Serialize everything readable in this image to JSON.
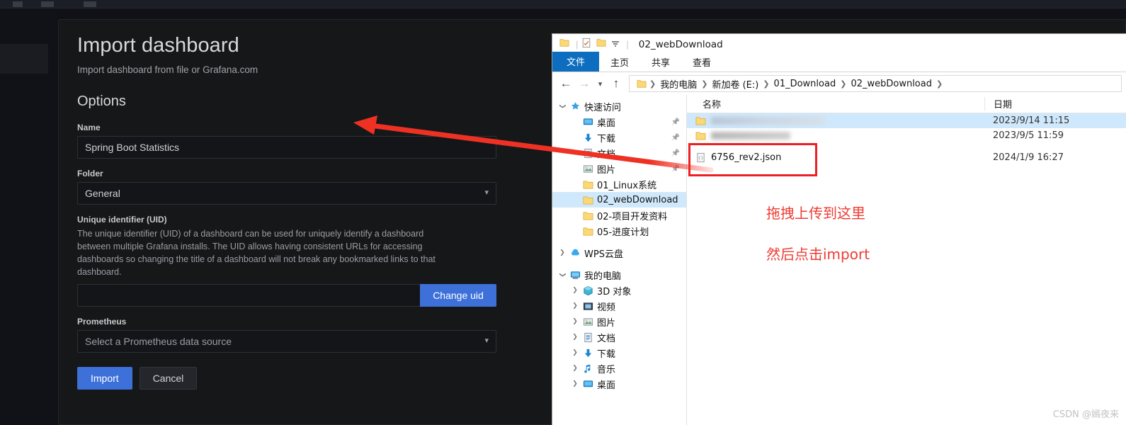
{
  "grafana": {
    "page_title": "Import dashboard",
    "page_subtitle": "Import dashboard from file or Grafana.com",
    "section_title": "Options",
    "name_field": {
      "label": "Name",
      "value": "Spring Boot Statistics"
    },
    "folder_field": {
      "label": "Folder",
      "value": "General",
      "chevron": "chevron-down-icon"
    },
    "uid_field": {
      "label": "Unique identifier (UID)",
      "description": "The unique identifier (UID) of a dashboard can be used for uniquely identify a dashboard between multiple Grafana installs. The UID allows having consistent URLs for accessing dashboards so changing the title of a dashboard will not break any bookmarked links to that dashboard.",
      "value": "",
      "button_label": "Change uid"
    },
    "datasource_field": {
      "label": "Prometheus",
      "placeholder": "Select a Prometheus data source",
      "value": "Select a Prometheus data source"
    },
    "import_button": "Import",
    "cancel_button": "Cancel"
  },
  "explorer": {
    "window_title": "02_webDownload",
    "quick_access_icons": [
      "folder-icon",
      "properties-icon",
      "new-folder-icon",
      "customize-toolbar-chevron-icon"
    ],
    "ribbon_tabs": [
      {
        "label": "文件",
        "active": true
      },
      {
        "label": "主页",
        "active": false
      },
      {
        "label": "共享",
        "active": false
      },
      {
        "label": "查看",
        "active": false
      }
    ],
    "nav": {
      "back": "back-arrow-icon",
      "forward": "forward-arrow-icon",
      "recent": "recent-locations-chevron-icon",
      "up": "up-arrow-icon"
    },
    "breadcrumbs": [
      "我的电脑",
      "新加卷 (E:)",
      "01_Download",
      "02_webDownload"
    ],
    "tree": [
      {
        "label": "快速访问",
        "icon": "pin-star-icon",
        "indent": 0,
        "arrow": "expanded",
        "selected": false,
        "pinned": false
      },
      {
        "label": "桌面",
        "icon": "desktop-icon",
        "indent": 1,
        "arrow": "none",
        "selected": false,
        "pinned": true
      },
      {
        "label": "下载",
        "icon": "download-icon",
        "indent": 1,
        "arrow": "none",
        "selected": false,
        "pinned": true
      },
      {
        "label": "文档",
        "icon": "documents-icon",
        "indent": 1,
        "arrow": "none",
        "selected": false,
        "pinned": true
      },
      {
        "label": "图片",
        "icon": "pictures-icon",
        "indent": 1,
        "arrow": "none",
        "selected": false,
        "pinned": true
      },
      {
        "label": "01_Linux系统",
        "icon": "folder-icon",
        "indent": 1,
        "arrow": "none",
        "selected": false,
        "pinned": false
      },
      {
        "label": "02_webDownload",
        "icon": "folder-icon",
        "indent": 1,
        "arrow": "none",
        "selected": true,
        "pinned": false
      },
      {
        "label": "02-项目开发资料",
        "icon": "folder-icon",
        "indent": 1,
        "arrow": "none",
        "selected": false,
        "pinned": false
      },
      {
        "label": "05-进度计划",
        "icon": "folder-icon",
        "indent": 1,
        "arrow": "none",
        "selected": false,
        "pinned": false
      },
      {
        "label": "WPS云盘",
        "icon": "cloud-icon",
        "indent": 0,
        "arrow": "collapsed",
        "selected": false,
        "pinned": false,
        "gap_before": true
      },
      {
        "label": "我的电脑",
        "icon": "computer-icon",
        "indent": 0,
        "arrow": "expanded",
        "selected": false,
        "pinned": false,
        "gap_before": true
      },
      {
        "label": "3D 对象",
        "icon": "3d-objects-icon",
        "indent": 1,
        "arrow": "collapsed",
        "selected": false,
        "pinned": false
      },
      {
        "label": "视频",
        "icon": "videos-icon",
        "indent": 1,
        "arrow": "collapsed",
        "selected": false,
        "pinned": false
      },
      {
        "label": "图片",
        "icon": "pictures-icon",
        "indent": 1,
        "arrow": "collapsed",
        "selected": false,
        "pinned": false
      },
      {
        "label": "文档",
        "icon": "documents-icon",
        "indent": 1,
        "arrow": "collapsed",
        "selected": false,
        "pinned": false
      },
      {
        "label": "下载",
        "icon": "download-icon",
        "indent": 1,
        "arrow": "collapsed",
        "selected": false,
        "pinned": false
      },
      {
        "label": "音乐",
        "icon": "music-icon",
        "indent": 1,
        "arrow": "collapsed",
        "selected": false,
        "pinned": false
      },
      {
        "label": "桌面",
        "icon": "desktop-icon",
        "indent": 1,
        "arrow": "collapsed",
        "selected": false,
        "pinned": false
      }
    ],
    "columns": [
      "名称",
      "日期"
    ],
    "files": [
      {
        "name": "",
        "blurred": true,
        "blur_style": "a",
        "icon": "folder-icon",
        "date": "2023/9/14 11:15",
        "selected": true
      },
      {
        "name": "",
        "blurred": true,
        "blur_style": "b",
        "icon": "folder-icon",
        "date": "2023/9/5 11:59",
        "selected": false
      },
      {
        "name": "6756_rev2.json",
        "blurred": false,
        "icon": "json-file-icon",
        "date": "2024/1/9 16:27",
        "selected": false
      }
    ]
  },
  "annotations": {
    "line1": "拖拽上传到这里",
    "line2": "然后点击import",
    "arrow_color": "#ef3124",
    "highlight_color": "#ec2024"
  },
  "watermark": "CSDN @嫣夜来"
}
